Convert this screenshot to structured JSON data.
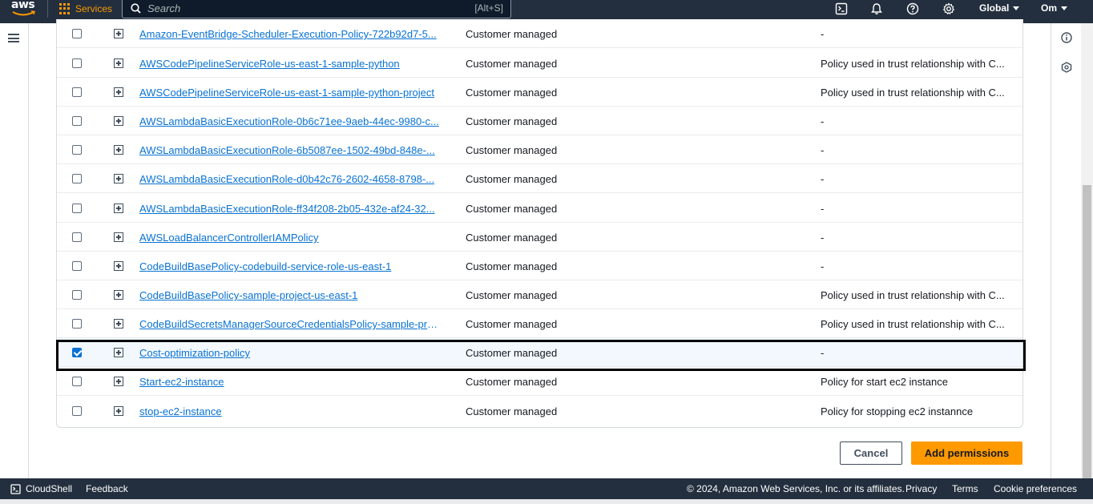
{
  "nav": {
    "logo": "aws",
    "services_label": "Services",
    "search_placeholder": "Search",
    "search_shortcut": "[Alt+S]",
    "region": "Global",
    "user": "Om",
    "icons": [
      "cloudshell-icon",
      "bell-icon",
      "help-icon",
      "settings-icon"
    ]
  },
  "policies": [
    {
      "name": "Amazon-EventBridge-Scheduler-Execution-Policy-722b92d7-5...",
      "type": "Customer managed",
      "description": "-",
      "checked": false
    },
    {
      "name": "AWSCodePipelineServiceRole-us-east-1-sample-python",
      "type": "Customer managed",
      "description": "Policy used in trust relationship with C...",
      "checked": false
    },
    {
      "name": "AWSCodePipelineServiceRole-us-east-1-sample-python-project",
      "type": "Customer managed",
      "description": "Policy used in trust relationship with C...",
      "checked": false
    },
    {
      "name": "AWSLambdaBasicExecutionRole-0b6c71ee-9aeb-44ec-9980-c...",
      "type": "Customer managed",
      "description": "-",
      "checked": false
    },
    {
      "name": "AWSLambdaBasicExecutionRole-6b5087ee-1502-49bd-848e-...",
      "type": "Customer managed",
      "description": "-",
      "checked": false
    },
    {
      "name": "AWSLambdaBasicExecutionRole-d0b42c76-2602-4658-8798-...",
      "type": "Customer managed",
      "description": "-",
      "checked": false
    },
    {
      "name": "AWSLambdaBasicExecutionRole-ff34f208-2b05-432e-af24-32...",
      "type": "Customer managed",
      "description": "-",
      "checked": false
    },
    {
      "name": "AWSLoadBalancerControllerIAMPolicy",
      "type": "Customer managed",
      "description": "-",
      "checked": false
    },
    {
      "name": "CodeBuildBasePolicy-codebuild-service-role-us-east-1",
      "type": "Customer managed",
      "description": "-",
      "checked": false
    },
    {
      "name": "CodeBuildBasePolicy-sample-project-us-east-1",
      "type": "Customer managed",
      "description": "Policy used in trust relationship with C...",
      "checked": false
    },
    {
      "name": "CodeBuildSecretsManagerSourceCredentialsPolicy-sample-pro...",
      "type": "Customer managed",
      "description": "Policy used in trust relationship with C...",
      "checked": false
    },
    {
      "name": "Cost-optimization-policy",
      "type": "Customer managed",
      "description": "-",
      "checked": true
    },
    {
      "name": "Start-ec2-instance",
      "type": "Customer managed",
      "description": "Policy for start ec2 instance",
      "checked": false
    },
    {
      "name": "stop-ec2-instance",
      "type": "Customer managed",
      "description": "Policy for stopping ec2 instannce",
      "checked": false
    }
  ],
  "actions": {
    "cancel": "Cancel",
    "add": "Add permissions"
  },
  "footer": {
    "cloudshell": "CloudShell",
    "feedback": "Feedback",
    "copyright": "© 2024, Amazon Web Services, Inc. or its affiliates.",
    "privacy": "Privacy",
    "terms": "Terms",
    "cookies": "Cookie preferences"
  },
  "colors": {
    "nav_bg": "#232f3e",
    "accent": "#ff9900",
    "link": "#0972d3"
  }
}
